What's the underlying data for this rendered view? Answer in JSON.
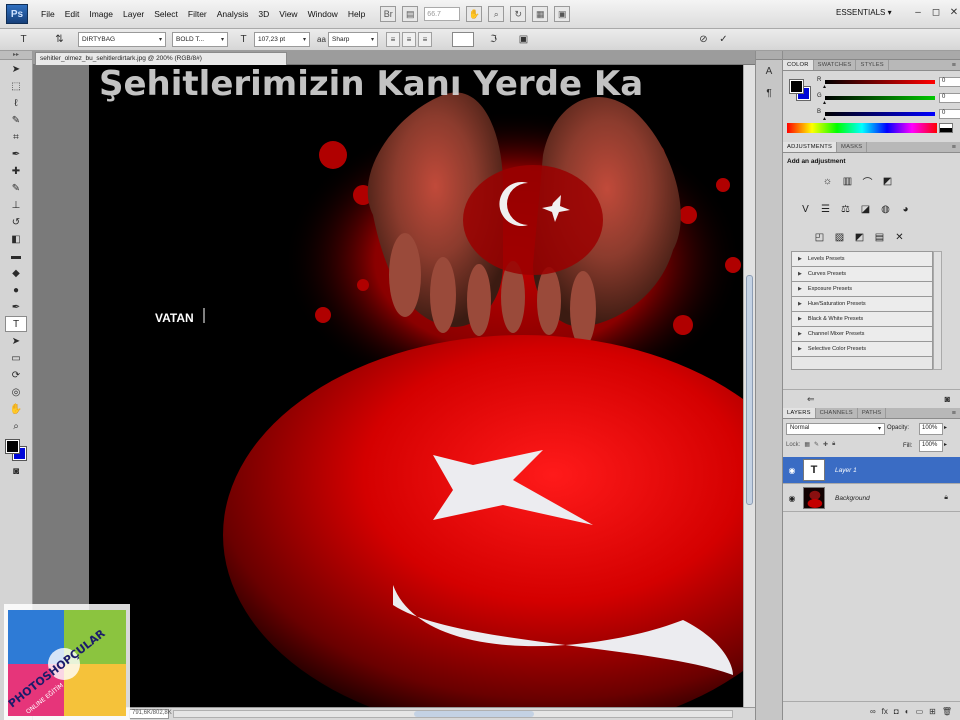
{
  "menubar": {
    "logo": "Ps",
    "items": [
      "File",
      "Edit",
      "Image",
      "Layer",
      "Select",
      "Filter",
      "Analysis",
      "3D",
      "View",
      "Window",
      "Help"
    ],
    "zoom": "66.7",
    "workspace": "ESSENTIALS",
    "workspace_arrow": "▾",
    "window_controls": [
      "–",
      "◻",
      "✕"
    ]
  },
  "options": {
    "font_family": "DIRTYBAG",
    "font_style": "BOLD T...",
    "font_size": "107,23 pt",
    "antialias": "Sharp",
    "cancel_icon": "⊘",
    "commit_icon": "✓"
  },
  "document": {
    "tab": "sehitler_olmez_bu_sehitlerdirtark.jpg @ 200% (RGB/8#)",
    "headline": "Şehitlerimizin Kanı Yerde Ka",
    "caption": "VATAN",
    "status_zoom": "791,6K/802,8K"
  },
  "color_panel": {
    "tabs": [
      "COLOR",
      "SWATCHES",
      "STYLES"
    ],
    "sliders": [
      {
        "label": "R",
        "value": "0",
        "color": "#ff0000"
      },
      {
        "label": "G",
        "value": "0",
        "color": "#00c800"
      },
      {
        "label": "B",
        "value": "0",
        "color": "#0000ff"
      }
    ],
    "foreground": "#000000",
    "background": "#0008d8"
  },
  "adjustments_panel": {
    "tabs": [
      "ADJUSTMENTS",
      "MASKS"
    ],
    "title": "Add an adjustment",
    "presets": [
      "Levels Presets",
      "Curves Presets",
      "Exposure Presets",
      "Hue/Saturation Presets",
      "Black & White Presets",
      "Channel Mixer Presets",
      "Selective Color Presets"
    ]
  },
  "layers_panel": {
    "tabs": [
      "LAYERS",
      "CHANNELS",
      "PATHS"
    ],
    "blend_mode": "Normal",
    "opacity_label": "Opacity:",
    "opacity": "100%",
    "lock_label": "Lock:",
    "fill_label": "Fill:",
    "fill": "100%",
    "layers": [
      {
        "name": "Layer 1",
        "thumb": "T"
      },
      {
        "name": "Background"
      }
    ]
  },
  "watermark": {
    "line1": "PHOTOSHOPÇULAR",
    "line2": "ONLINE EĞİTİM"
  }
}
